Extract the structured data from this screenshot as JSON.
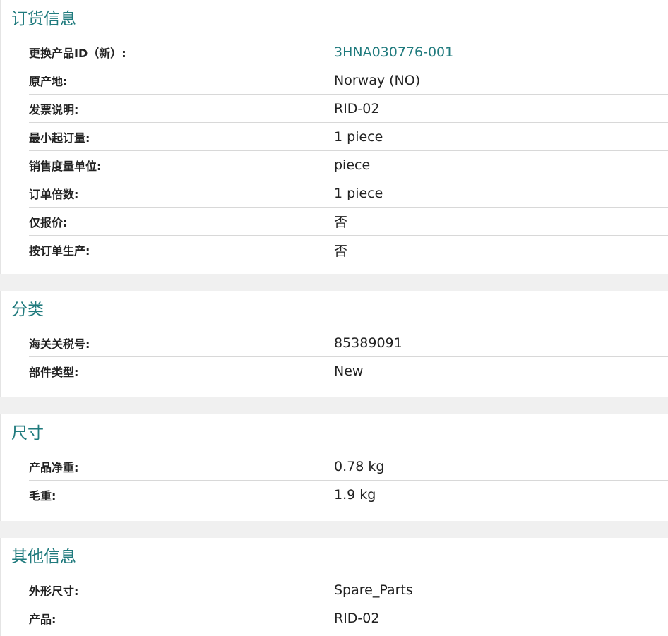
{
  "sections": [
    {
      "title": "订货信息",
      "rows": [
        {
          "label": "更换产品ID（新）:",
          "value": "3HNA030776-001"
        },
        {
          "label": "原产地:",
          "value": "Norway (NO)"
        },
        {
          "label": "发票说明:",
          "value": "RID-02"
        },
        {
          "label": "最小起订量:",
          "value": "1 piece"
        },
        {
          "label": "销售度量单位:",
          "value": "piece"
        },
        {
          "label": "订单倍数:",
          "value": "1 piece"
        },
        {
          "label": "仅报价:",
          "value": "否"
        },
        {
          "label": "按订单生产:",
          "value": "否"
        }
      ]
    },
    {
      "title": "分类",
      "rows": [
        {
          "label": "海关关税号:",
          "value": "85389091"
        },
        {
          "label": "部件类型:",
          "value": "New"
        }
      ]
    },
    {
      "title": "尺寸",
      "rows": [
        {
          "label": "产品净重:",
          "value": "0.78 kg"
        },
        {
          "label": "毛重:",
          "value": "1.9 kg"
        }
      ]
    },
    {
      "title": "其他信息",
      "rows": [
        {
          "label": "外形尺寸:",
          "value": "Spare_Parts"
        },
        {
          "label": "产品:",
          "value": "RID-02"
        }
      ]
    }
  ],
  "colors": {
    "accent": "#1f7a7d",
    "text": "#222222",
    "divider": "#d8d8d8",
    "background": "#f0f0f0"
  }
}
